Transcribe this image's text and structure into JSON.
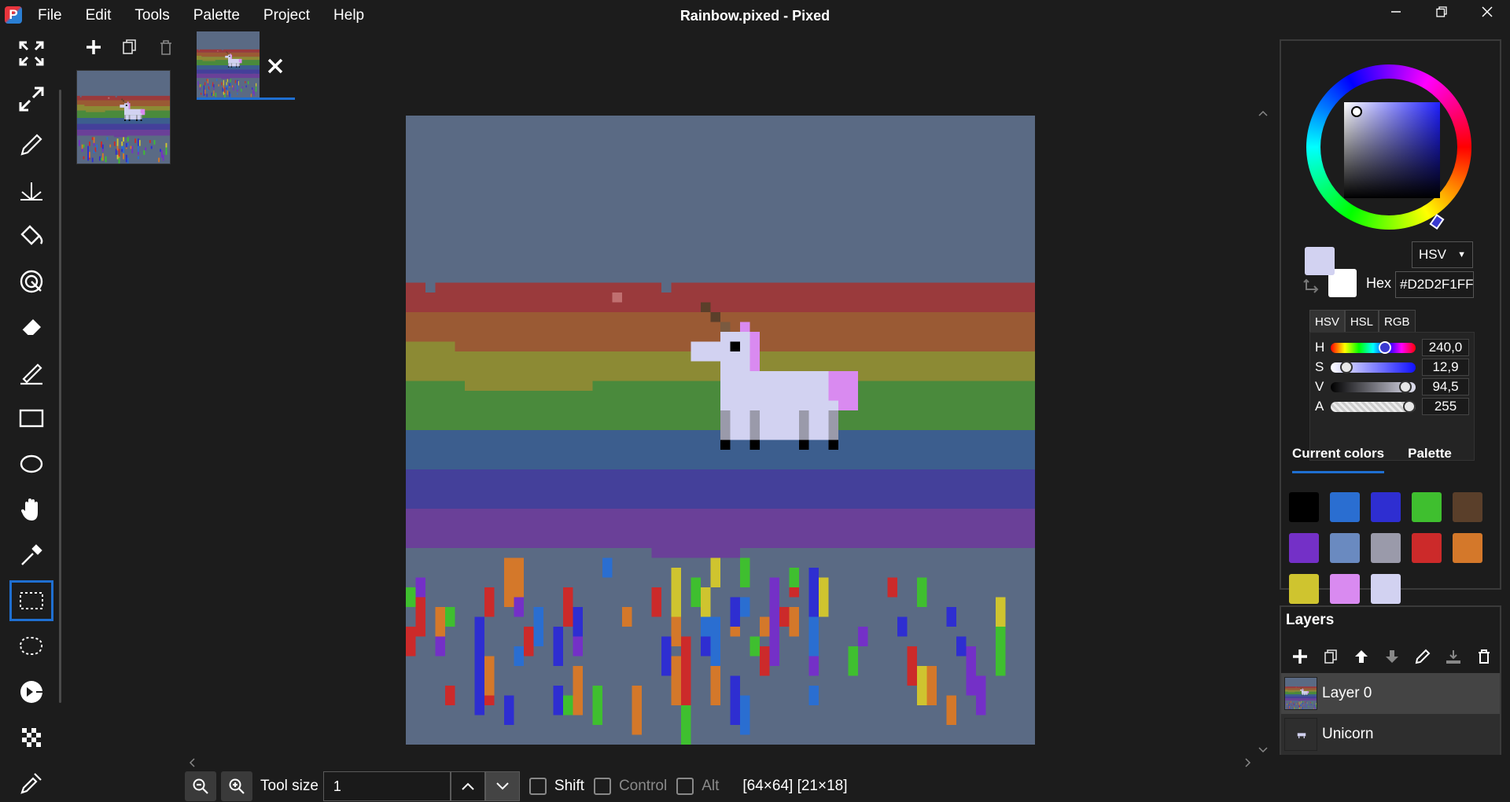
{
  "app": {
    "logo_letter": "P",
    "window_title": "Rainbow.pixed - Pixed"
  },
  "menu": [
    "File",
    "Edit",
    "Tools",
    "Palette",
    "Project",
    "Help"
  ],
  "tools": [
    {
      "name": "fullscreen-icon"
    },
    {
      "name": "expand-icon"
    },
    {
      "name": "pencil-icon"
    },
    {
      "name": "symmetry-brush-icon"
    },
    {
      "name": "fill-bucket-icon"
    },
    {
      "name": "spray-icon"
    },
    {
      "name": "eraser-icon"
    },
    {
      "name": "line-icon"
    },
    {
      "name": "rectangle-icon"
    },
    {
      "name": "ellipse-icon"
    },
    {
      "name": "hand-icon"
    },
    {
      "name": "color-picker-icon"
    },
    {
      "name": "rectangle-select-icon",
      "selected": true
    },
    {
      "name": "lasso-select-icon"
    },
    {
      "name": "magic-wand-icon"
    },
    {
      "name": "checker-pattern-icon"
    },
    {
      "name": "eyedropper-icon"
    }
  ],
  "bottom": {
    "tool_size_label": "Tool size",
    "tool_size_value": "1",
    "shift_label": "Shift",
    "control_label": "Control",
    "alt_label": "Alt",
    "status_text": "[64×64] [21×18]"
  },
  "color": {
    "mode": "HSV",
    "hex_label": "Hex",
    "hex_value": "#D2D2F1FF",
    "primary": "#d2d2f1",
    "secondary": "#ffffff",
    "model_tabs": [
      "HSV",
      "HSL",
      "RGB"
    ],
    "sliders": [
      {
        "label": "H",
        "value": "240,0",
        "fraction": 0.667
      },
      {
        "label": "S",
        "value": "12,9",
        "fraction": 0.129
      },
      {
        "label": "V",
        "value": "94,5",
        "fraction": 0.945
      },
      {
        "label": "A",
        "value": "255",
        "fraction": 1.0
      }
    ],
    "palette_tabs": [
      "Current colors",
      "Palette"
    ],
    "current_colors": [
      "#000000",
      "#2a6ed1",
      "#2e2ed1",
      "#3fbf2f",
      "#5a3f2a",
      "#7430c7",
      "#6a8ac0",
      "#9a9aaa",
      "#cc2a2a",
      "#d4782a",
      "#cfc42f",
      "#d98af0",
      "#d2d2f1"
    ]
  },
  "layers": {
    "title": "Layers",
    "items": [
      "Layer 0",
      "Unicorn"
    ]
  },
  "canvas": {
    "bg": "#5a6a84",
    "stripes": [
      "#9a3a3c",
      "#9a5a34",
      "#8c8a34",
      "#4a8a3c",
      "#3c5e8e",
      "#44409a",
      "#6a4098"
    ]
  }
}
